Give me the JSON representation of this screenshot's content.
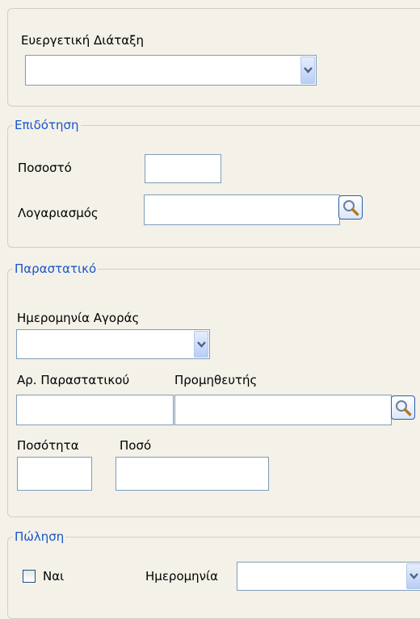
{
  "beneficial_provision": {
    "label": "Ευεργετική Διάταξη",
    "value": ""
  },
  "subsidy": {
    "legend": "Επιδότηση",
    "percentage_label": "Ποσοστό",
    "percentage_value": "",
    "account_label": "Λογαριασμός",
    "account_value": ""
  },
  "document": {
    "legend": "Παραστατικό",
    "purchase_date_label": "Ημερομηνία Αγοράς",
    "purchase_date_value": "",
    "document_number_label": "Αρ. Παραστατικού",
    "document_number_value": "",
    "supplier_label": "Προμηθευτής",
    "supplier_value": "",
    "quantity_label": "Ποσότητα",
    "quantity_value": "",
    "amount_label": "Ποσό",
    "amount_value": ""
  },
  "sale": {
    "legend": "Πώληση",
    "yes_label": "Ναι",
    "yes_checked": false,
    "date_label": "Ημερομηνία",
    "date_value": ""
  },
  "icons": {
    "dropdown": "chevron-down-icon",
    "search": "magnifier-icon",
    "checkbox": "checkbox-icon"
  },
  "colors": {
    "background": "#f3f1e8",
    "legend_text": "#1a55c9",
    "field_border": "#7f9db9",
    "panel_border": "#d3cfbf"
  }
}
